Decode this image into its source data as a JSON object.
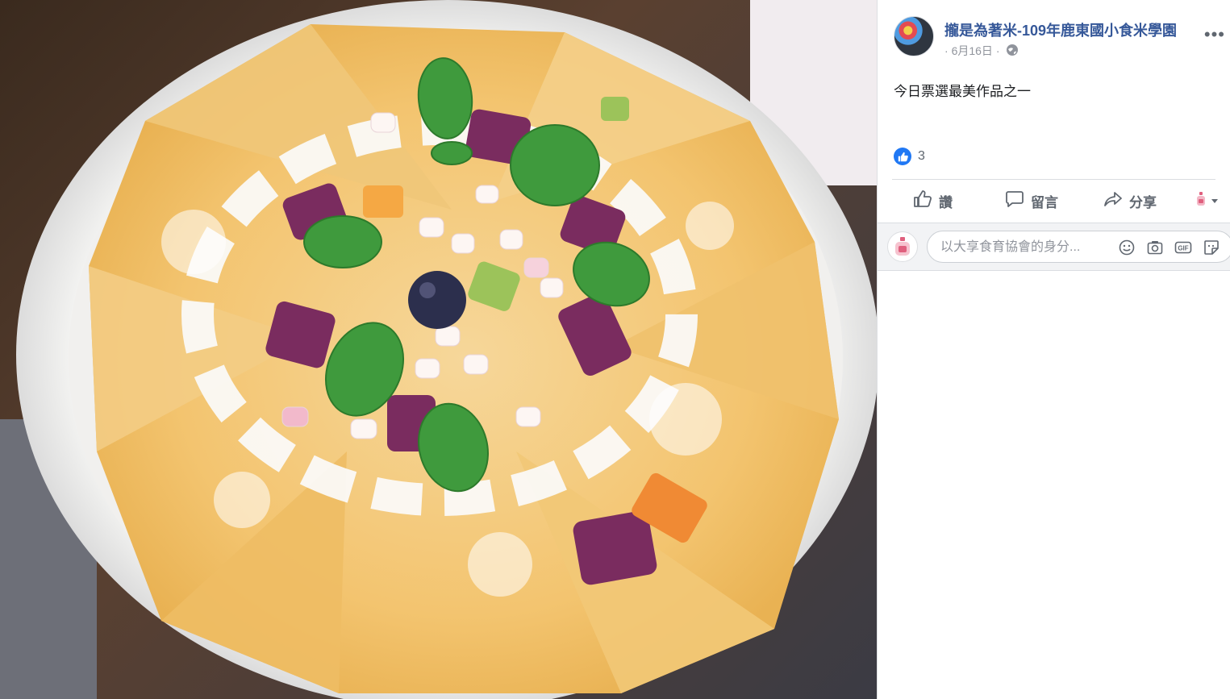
{
  "post": {
    "page_name": "攏是為著米-109年鹿東國小食米學園",
    "date": "6月16日",
    "meta_separator": "·",
    "caption": "今日票選最美作品之一",
    "like_count": "3"
  },
  "actions": {
    "like": "讚",
    "comment": "留言",
    "share": "分享"
  },
  "comment_box": {
    "placeholder": "以大享食育協會的身分..."
  },
  "colors": {
    "link_blue": "#365899",
    "like_blue": "#2078f4",
    "muted_gray": "#606770",
    "divider": "#dadde1"
  },
  "icons": [
    "globe-icon",
    "more-icon",
    "like-icon",
    "comment-icon",
    "share-icon",
    "view-as-icon",
    "emoji-icon",
    "camera-icon",
    "gif-icon",
    "sticker-icon"
  ]
}
